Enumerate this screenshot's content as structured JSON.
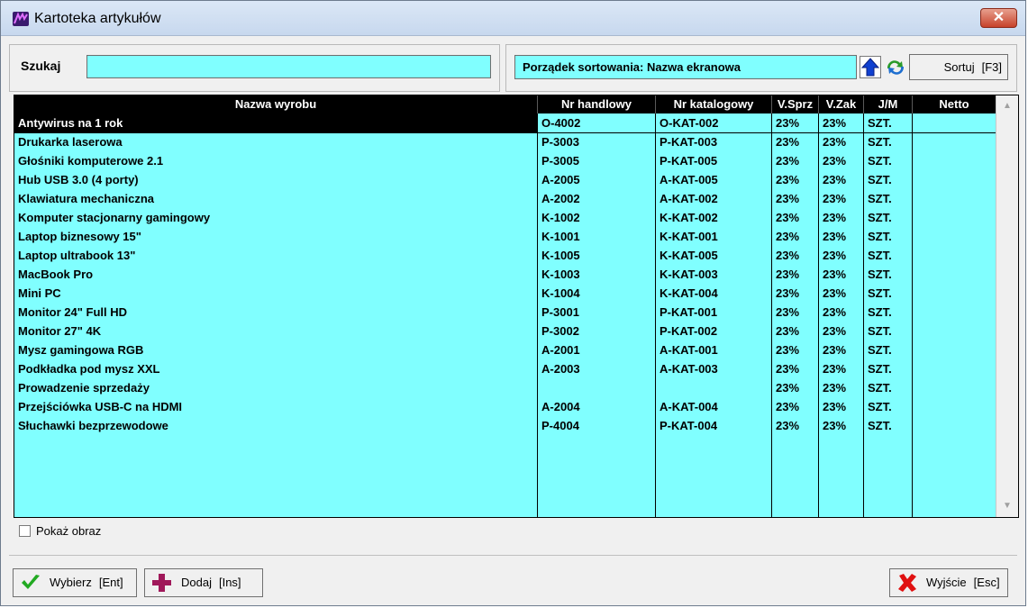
{
  "window": {
    "title": "Kartoteka artykułów",
    "close_glyph": "✕"
  },
  "search": {
    "label": "Szukaj",
    "value": ""
  },
  "sort": {
    "order_text": "Porządek sortowania: Nazwa ekranowa",
    "button_label": "Sortuj",
    "button_shortcut": "[F3]"
  },
  "table": {
    "columns": [
      "Nazwa wyrobu",
      "Nr handlowy",
      "Nr katalogowy",
      "V.Sprz",
      "V.Zak",
      "J/M",
      "Netto"
    ],
    "rows": [
      [
        "Antywirus na 1 rok",
        "O-4002",
        "O-KAT-002",
        "23%",
        "23%",
        "SZT.",
        ""
      ],
      [
        "Drukarka laserowa",
        "P-3003",
        "P-KAT-003",
        "23%",
        "23%",
        "SZT.",
        ""
      ],
      [
        "Głośniki komputerowe 2.1",
        "P-3005",
        "P-KAT-005",
        "23%",
        "23%",
        "SZT.",
        ""
      ],
      [
        "Hub USB 3.0 (4 porty)",
        "A-2005",
        "A-KAT-005",
        "23%",
        "23%",
        "SZT.",
        ""
      ],
      [
        "Klawiatura mechaniczna",
        "A-2002",
        "A-KAT-002",
        "23%",
        "23%",
        "SZT.",
        ""
      ],
      [
        "Komputer stacjonarny gamingowy",
        "K-1002",
        "K-KAT-002",
        "23%",
        "23%",
        "SZT.",
        ""
      ],
      [
        "Laptop biznesowy 15\"",
        "K-1001",
        "K-KAT-001",
        "23%",
        "23%",
        "SZT.",
        ""
      ],
      [
        "Laptop ultrabook 13\"",
        "K-1005",
        "K-KAT-005",
        "23%",
        "23%",
        "SZT.",
        ""
      ],
      [
        "MacBook Pro",
        "K-1003",
        "K-KAT-003",
        "23%",
        "23%",
        "SZT.",
        ""
      ],
      [
        "Mini PC",
        "K-1004",
        "K-KAT-004",
        "23%",
        "23%",
        "SZT.",
        ""
      ],
      [
        "Monitor 24\" Full HD",
        "P-3001",
        "P-KAT-001",
        "23%",
        "23%",
        "SZT.",
        ""
      ],
      [
        "Monitor 27\" 4K",
        "P-3002",
        "P-KAT-002",
        "23%",
        "23%",
        "SZT.",
        ""
      ],
      [
        "Mysz gamingowa RGB",
        "A-2001",
        "A-KAT-001",
        "23%",
        "23%",
        "SZT.",
        ""
      ],
      [
        "Podkładka pod mysz XXL",
        "A-2003",
        "A-KAT-003",
        "23%",
        "23%",
        "SZT.",
        ""
      ],
      [
        "Prowadzenie sprzedaży",
        "",
        "",
        "23%",
        "23%",
        "SZT.",
        ""
      ],
      [
        "Przejściówka USB-C na HDMI",
        "A-2004",
        "A-KAT-004",
        "23%",
        "23%",
        "SZT.",
        ""
      ],
      [
        "Słuchawki bezprzewodowe",
        "P-4004",
        "P-KAT-004",
        "23%",
        "23%",
        "SZT.",
        ""
      ]
    ],
    "selected_row": 0
  },
  "show_image": {
    "label": "Pokaż obraz",
    "checked": false
  },
  "buttons": {
    "select_label": "Wybierz",
    "select_shortcut": "[Ent]",
    "add_label": "Dodaj",
    "add_shortcut": "[Ins]",
    "exit_label": "Wyjście",
    "exit_shortcut": "[Esc]"
  },
  "colors": {
    "grid_bg": "#80ffff",
    "header_bg": "#000000",
    "accent_check": "#22aa22",
    "accent_add": "#a0185a",
    "accent_exit": "#e01010"
  }
}
